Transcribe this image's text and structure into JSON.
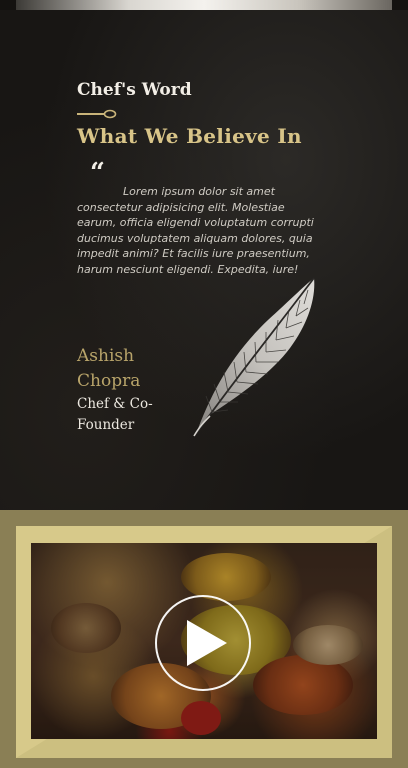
{
  "chef_section": {
    "kicker": "Chef's Word",
    "title": "What We Believe In",
    "quote_mark": "“",
    "quote": "Lorem ipsum dolor sit amet consectetur adipisicing elit. Molestiae earum, officia eligendi voluptatum corrupti ducimus voluptatem aliquam dolores, quia impedit animi? Et facilis iure praesentium, harum nesciunt eligendi. Expedita, iure!",
    "author_name": "Ashish Chopra",
    "author_role": "Chef & Co-Founder"
  },
  "colors": {
    "accent_gold": "#d8c488",
    "author_gold": "#b8a46a",
    "frame": "#d7c98a",
    "band": "#8a7f55"
  },
  "icons": {
    "quote": "quote-icon",
    "divider": "spoon-divider-icon",
    "feather": "feather-icon",
    "play": "play-icon"
  }
}
